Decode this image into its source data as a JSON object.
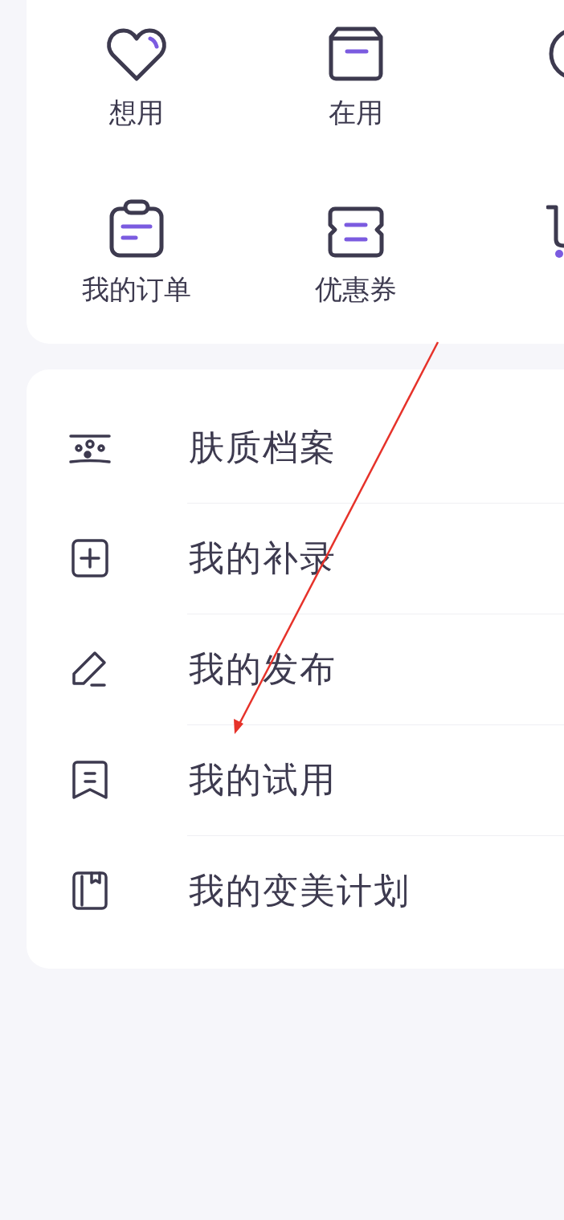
{
  "shortcuts": [
    {
      "label": "想用"
    },
    {
      "label": "在用"
    },
    {
      "label": "我的订单"
    },
    {
      "label": "优惠券"
    }
  ],
  "menu": [
    {
      "label": "肤质档案"
    },
    {
      "label": "我的补录"
    },
    {
      "label": "我的发布"
    },
    {
      "label": "我的试用"
    },
    {
      "label": "我的变美计划"
    }
  ]
}
